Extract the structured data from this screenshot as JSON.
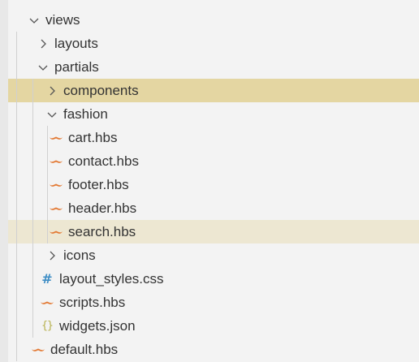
{
  "tree": [
    {
      "label": "views",
      "type": "folder",
      "expanded": true,
      "depth": 0
    },
    {
      "label": "layouts",
      "type": "folder",
      "expanded": false,
      "depth": 1
    },
    {
      "label": "partials",
      "type": "folder",
      "expanded": true,
      "depth": 1
    },
    {
      "label": "components",
      "type": "folder",
      "expanded": false,
      "depth": 2,
      "state": "selected"
    },
    {
      "label": "fashion",
      "type": "folder",
      "expanded": true,
      "depth": 2
    },
    {
      "label": "cart.hbs",
      "type": "handlebars",
      "depth": 3
    },
    {
      "label": "contact.hbs",
      "type": "handlebars",
      "depth": 3
    },
    {
      "label": "footer.hbs",
      "type": "handlebars",
      "depth": 3
    },
    {
      "label": "header.hbs",
      "type": "handlebars",
      "depth": 3
    },
    {
      "label": "search.hbs",
      "type": "handlebars",
      "depth": 3,
      "state": "hover"
    },
    {
      "label": "icons",
      "type": "folder",
      "expanded": false,
      "depth": 2
    },
    {
      "label": "layout_styles.css",
      "type": "css",
      "depth": 2
    },
    {
      "label": "scripts.hbs",
      "type": "handlebars",
      "depth": 2
    },
    {
      "label": "widgets.json",
      "type": "json",
      "depth": 2
    },
    {
      "label": "default.hbs",
      "type": "handlebars",
      "depth": 1
    }
  ],
  "colors": {
    "background": "#f3f3f3",
    "selected": "#e4d6a2",
    "hover": "#ede7d2",
    "text": "#333333",
    "handlebars_icon": "#e37933",
    "css_icon": "#3f8ec5",
    "json_icon": "#b6b04c"
  }
}
